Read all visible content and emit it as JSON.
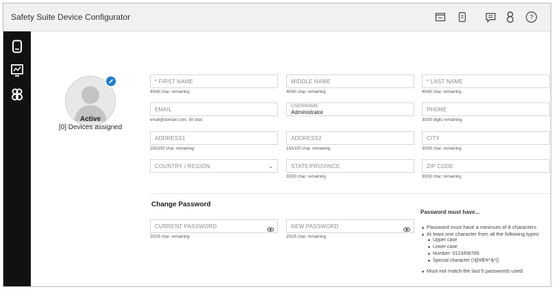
{
  "app": {
    "title": "Safety Suite Device Configurator"
  },
  "header_icons": [
    "monitor-icon",
    "device-doc-icon",
    "chat-icon",
    "user-icon",
    "help-icon"
  ],
  "sidebar_icons": [
    "device-icon",
    "dashboard-icon",
    "users-icon"
  ],
  "profile": {
    "status": "Active",
    "devices_assigned": "[0] Devices assigned"
  },
  "fields": {
    "first_name": {
      "placeholder": "* FIRST NAME",
      "hint": "40/40 char. remaining"
    },
    "middle_name": {
      "placeholder": "MIDDLE NAME",
      "hint": "40/40 char. remaining"
    },
    "last_name": {
      "placeholder": "* LAST NAME",
      "hint": "40/40 char. remaining"
    },
    "email": {
      "placeholder": "EMAIL",
      "hint": "email@domain.com, 50 char."
    },
    "username": {
      "label": "USERNAME",
      "value": "Administrator"
    },
    "phone": {
      "placeholder": "PHONE",
      "hint": "30/30 digits remaining"
    },
    "address1": {
      "placeholder": "ADDRESS1",
      "hint": "150/150 char. remaining"
    },
    "address2": {
      "placeholder": "ADDRESS2",
      "hint": "150/150 char. remaining"
    },
    "city": {
      "placeholder": "CITY",
      "hint": "30/30 char. remaining"
    },
    "country": {
      "placeholder": "COUNTRY / REGION"
    },
    "state": {
      "placeholder": "STATE/PROVINCE",
      "hint": "30/30 char. remaining"
    },
    "zip": {
      "placeholder": "ZIP CODE",
      "hint": "30/30 char. remaining"
    }
  },
  "password": {
    "title": "Change Password",
    "current": {
      "placeholder": "CURRENT PASSWORD",
      "hint": "25/25 char. remaining"
    },
    "new": {
      "placeholder": "NEW PASSWORD",
      "hint": "25/25 char. remaining"
    },
    "rules_title": "Password must have...",
    "rules": [
      "Password must have a minimum of 8 characters.",
      "At least one character from all the following types:",
      "Upper case",
      "Lower case",
      "Number: 0123456789",
      "Special character (!@#$%^&*()",
      "Must not match the last 5 passwords used."
    ]
  },
  "colors": {
    "accent": "#1a7ed1",
    "sidebar": "#111111",
    "header": "#f1f1f1"
  }
}
